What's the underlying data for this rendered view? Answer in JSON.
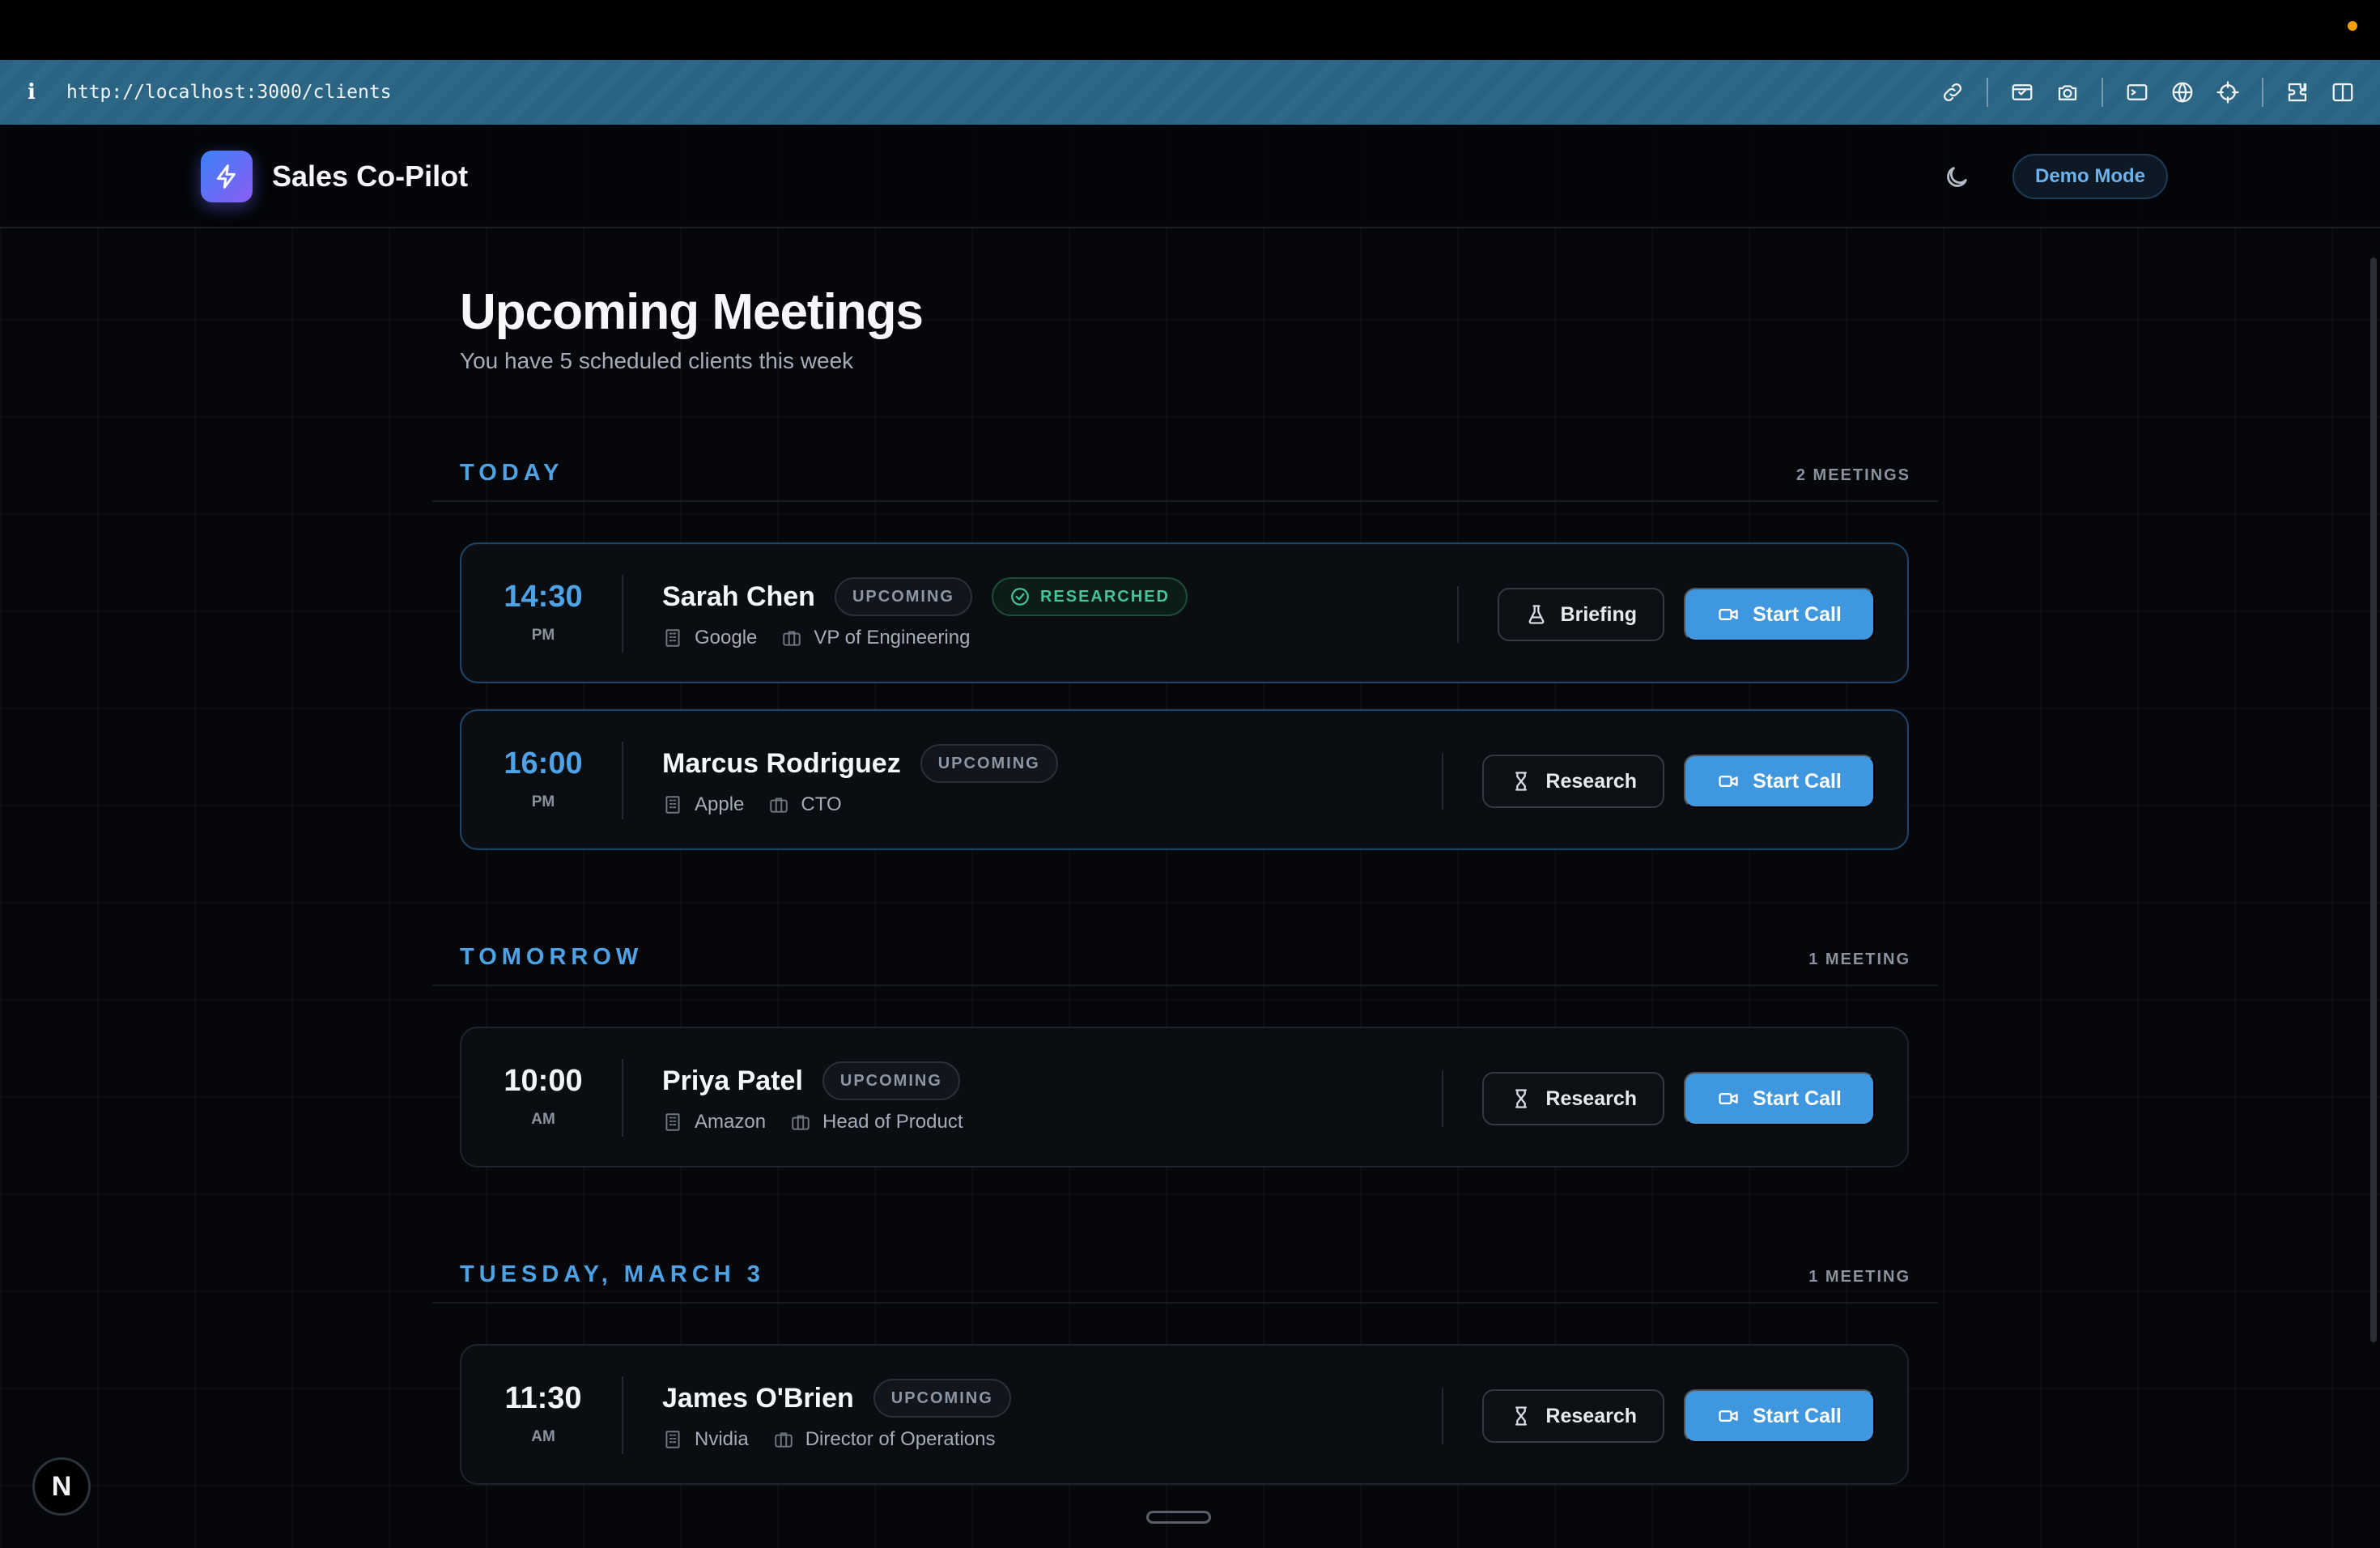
{
  "browser": {
    "url": "http://localhost:3000/clients",
    "info_glyph": "i",
    "tools": [
      "link-icon",
      "inspect-icon",
      "camera-icon",
      "terminal-icon",
      "globe-icon",
      "crosshair-icon",
      "extension-icon",
      "sidebar-icon"
    ]
  },
  "app": {
    "name": "Sales Co-Pilot",
    "demo_label": "Demo Mode",
    "accent": "#3f97e0",
    "brand_gradient": [
      "#3b82f6",
      "#8b5cf6"
    ]
  },
  "page": {
    "title": "Upcoming Meetings",
    "subtitle": "You have 5 scheduled clients this week"
  },
  "sections": [
    {
      "title": "TODAY",
      "count": "2 MEETINGS",
      "meetings": [
        {
          "time": "14:30",
          "ampm": "PM",
          "name": "Sarah Chen",
          "status": "UPCOMING",
          "researched": "RESEARCHED",
          "company": "Google",
          "role": "VP of Engineering",
          "secondary_action": "Briefing",
          "primary_action": "Start Call"
        },
        {
          "time": "16:00",
          "ampm": "PM",
          "name": "Marcus Rodriguez",
          "status": "UPCOMING",
          "company": "Apple",
          "role": "CTO",
          "secondary_action": "Research",
          "primary_action": "Start Call"
        }
      ]
    },
    {
      "title": "TOMORROW",
      "count": "1 MEETING",
      "meetings": [
        {
          "time": "10:00",
          "ampm": "AM",
          "name": "Priya Patel",
          "status": "UPCOMING",
          "company": "Amazon",
          "role": "Head of Product",
          "secondary_action": "Research",
          "primary_action": "Start Call"
        }
      ]
    },
    {
      "title": "TUESDAY, MARCH 3",
      "count": "1 MEETING",
      "meetings": [
        {
          "time": "11:30",
          "ampm": "AM",
          "name": "James O'Brien",
          "status": "UPCOMING",
          "company": "Nvidia",
          "role": "Director of Operations",
          "secondary_action": "Research",
          "primary_action": "Start Call"
        }
      ]
    }
  ],
  "dev_badge": "N"
}
